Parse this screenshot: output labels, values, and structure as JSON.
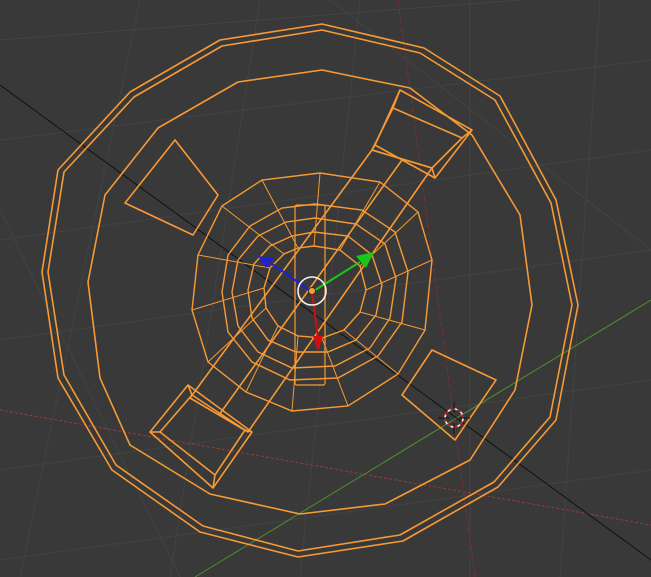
{
  "viewport": {
    "kind": "3d-viewport",
    "shading": "wireframe",
    "selection_color": "#f79a35",
    "background_color": "#393939",
    "grid_color": "#434343",
    "axis_x_color": "#9a3a3a",
    "axis_y_color": "#4f8f2a",
    "gizmo": {
      "x_arrow_color": "#d01010",
      "y_arrow_color": "#18c818",
      "z_arrow_color": "#2020d8"
    },
    "cursor_icon": "3d-cursor-icon",
    "origin_icon": "object-origin-icon"
  }
}
